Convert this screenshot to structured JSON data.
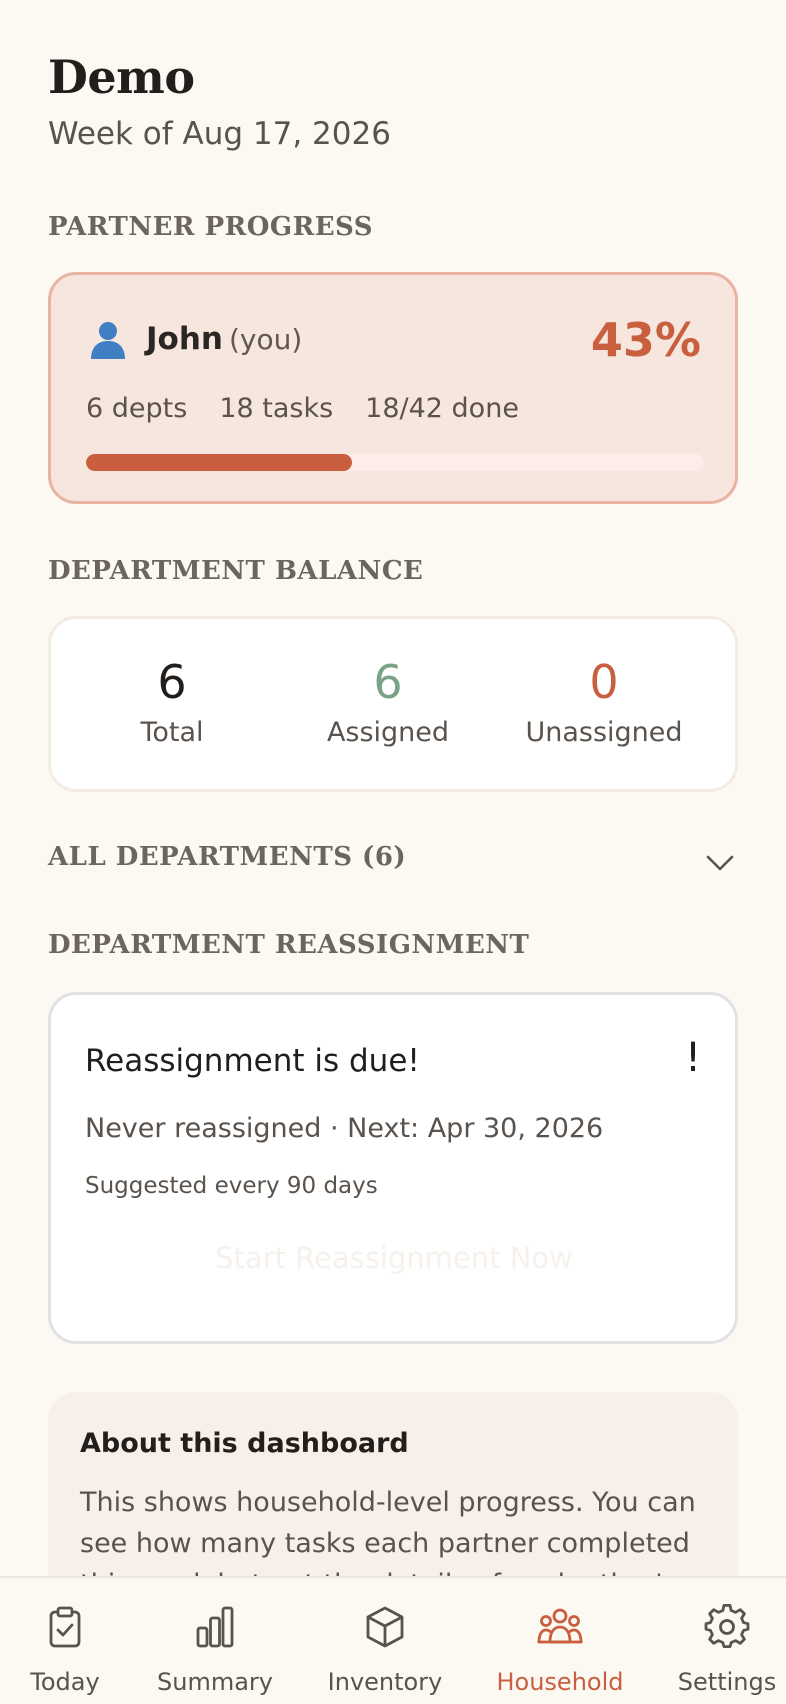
{
  "header": {
    "title": "Demo",
    "subtitle": "Week of Aug 17, 2026"
  },
  "sections": {
    "partner_progress": "PARTNER PROGRESS",
    "department_balance": "DEPARTMENT BALANCE",
    "all_departments": "ALL DEPARTMENTS (6)",
    "department_reassignment": "DEPARTMENT REASSIGNMENT"
  },
  "partner": {
    "icon": "person-icon",
    "name": "John",
    "you_label": "(you)",
    "percent": "43%",
    "progress": 0.43,
    "depts": "6 depts",
    "tasks": "18 tasks",
    "done": "18/42 done"
  },
  "balance": {
    "total_value": "6",
    "total_label": "Total",
    "assigned_value": "6",
    "assigned_label": "Assigned",
    "unassigned_value": "0",
    "unassigned_label": "Unassigned"
  },
  "reassignment": {
    "title": "Reassignment is due!",
    "alert": "!",
    "status": "Never reassigned · Next: Apr 30, 2026",
    "suggested": "Suggested every 90 days",
    "button_label": "Start Reassignment Now"
  },
  "about": {
    "title": "About this dashboard",
    "text": "This shows household-level progress. You can see how many tasks each partner completed this week but not the details of each other's"
  },
  "tabs": [
    {
      "label": "Today",
      "icon": "clipboard-check-icon",
      "active": false
    },
    {
      "label": "Summary",
      "icon": "bar-chart-icon",
      "active": false
    },
    {
      "label": "Inventory",
      "icon": "box-icon",
      "active": false
    },
    {
      "label": "Household",
      "icon": "people-icon",
      "active": true
    },
    {
      "label": "Settings",
      "icon": "gear-icon",
      "active": false
    }
  ],
  "colors": {
    "accent": "#c95f3f",
    "assigned_green": "#7aa386",
    "background": "#fcf8f2"
  }
}
